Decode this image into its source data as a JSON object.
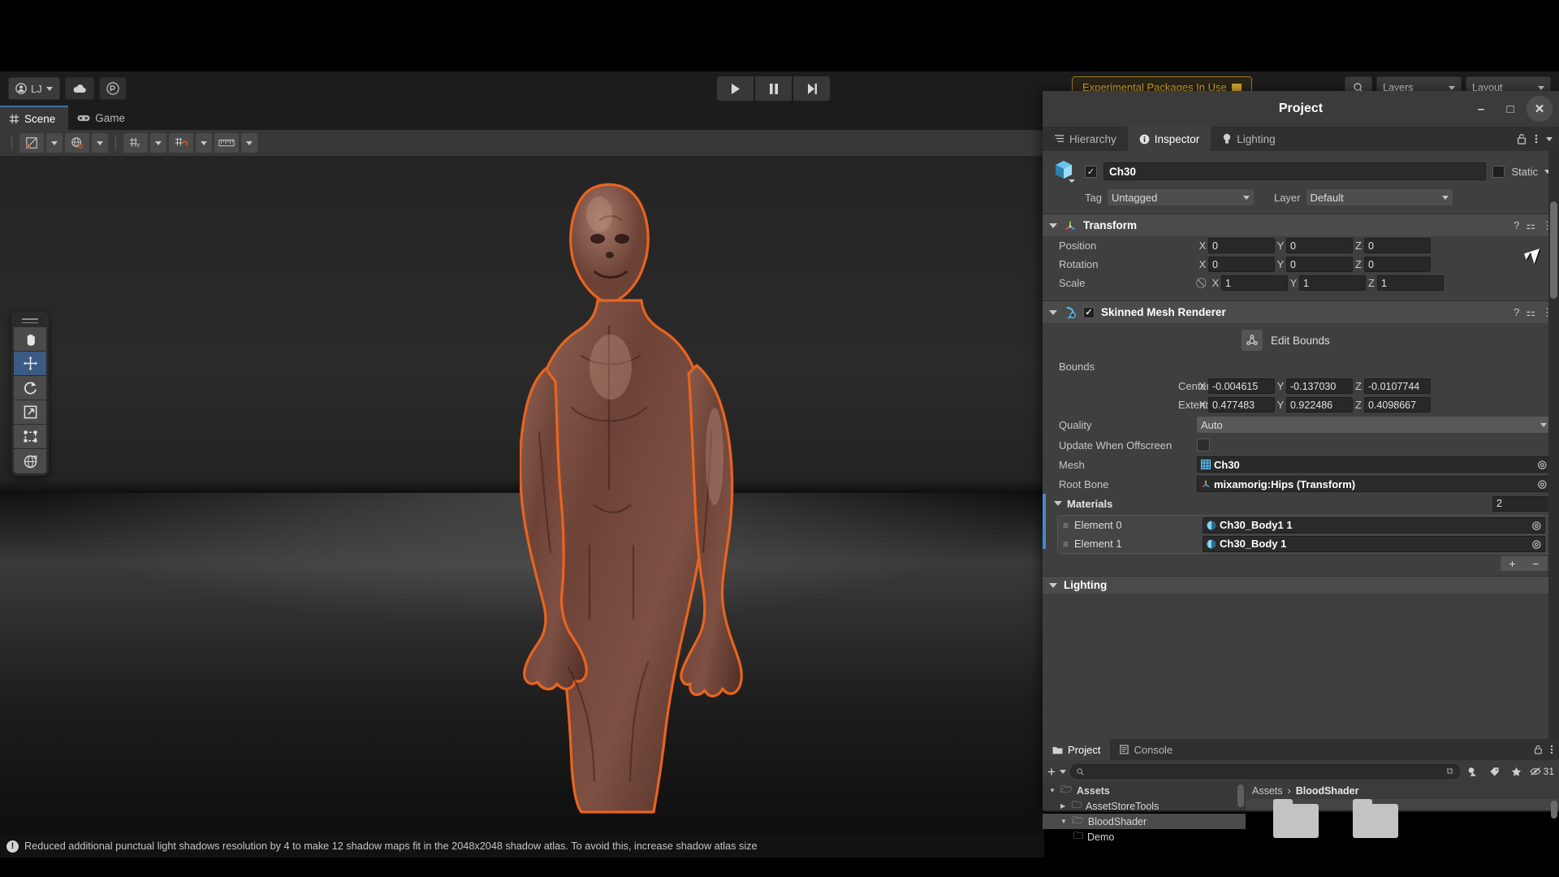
{
  "toolbar": {
    "account_label": "LJ",
    "account_icon": "person-icon",
    "cloud_icon": "cloud-icon",
    "packages_icon": "package-manager-icon",
    "play_icon": "play-icon",
    "pause_icon": "pause-icon",
    "step_icon": "step-icon",
    "experimental_badge": "Experimental Packages In Use",
    "layers_label": "Layers",
    "layout_label": "Layout",
    "search_icon": "search-icon",
    "undo_icon": "undo-icon"
  },
  "scene": {
    "tabs": [
      {
        "label": "Scene",
        "icon": "grid-icon",
        "active": true
      },
      {
        "label": "Game",
        "icon": "gamepad-icon",
        "active": false
      }
    ],
    "toolbar_icons": [
      "shading-mode-icon",
      "world-local-icon",
      "grid-snap-icon",
      "snap-increment-icon",
      "ruler-icon"
    ],
    "tools": [
      {
        "name": "hand-tool",
        "glyph": "✋",
        "selected": false
      },
      {
        "name": "move-tool",
        "glyph": "✥",
        "selected": true
      },
      {
        "name": "rotate-tool",
        "glyph": "↻",
        "selected": false
      },
      {
        "name": "scale-tool",
        "glyph": "↗",
        "selected": false
      },
      {
        "name": "rect-tool",
        "glyph": "⬚",
        "selected": false
      },
      {
        "name": "transform-tool",
        "glyph": "⬤",
        "selected": false
      }
    ],
    "status_message": "Reduced additional punctual light shadows resolution by 4 to make 12 shadow maps fit in the 2048x2048 shadow atlas. To avoid this, increase shadow atlas size",
    "status_icon": "info-icon"
  },
  "project_window": {
    "title": "Project",
    "minimize_label": "–",
    "maximize_label": "□",
    "close_label": "✕"
  },
  "inspector": {
    "tabs": [
      {
        "label": "Hierarchy",
        "icon": "hierarchy-icon",
        "active": false
      },
      {
        "label": "Inspector",
        "icon": "info-icon",
        "active": true
      },
      {
        "label": "Lighting",
        "icon": "bulb-icon",
        "active": false
      }
    ],
    "lock_icon": "lock-icon",
    "menu_icon": "kebab-icon",
    "object": {
      "enabled": true,
      "name": "Ch30",
      "static_label": "Static",
      "static_checked": false,
      "tag_label": "Tag",
      "tag_value": "Untagged",
      "layer_label": "Layer",
      "layer_value": "Default"
    },
    "transform": {
      "title": "Transform",
      "expanded": true,
      "rows": [
        {
          "label": "Position",
          "x": "0",
          "y": "0",
          "z": "0"
        },
        {
          "label": "Rotation",
          "x": "0",
          "y": "0",
          "z": "0"
        },
        {
          "label": "Scale",
          "x": "1",
          "y": "1",
          "z": "1",
          "constrain_icon": "link-off-icon"
        }
      ]
    },
    "skinned_mesh_renderer": {
      "title": "Skinned Mesh Renderer",
      "enabled": true,
      "expanded": true,
      "edit_bounds_label": "Edit Bounds",
      "edit_bounds_icon": "edit-bounds-icon",
      "bounds_label": "Bounds",
      "center": {
        "label": "Center",
        "x": "-0.004615",
        "y": "-0.137030",
        "z": "-0.0107744"
      },
      "extent": {
        "label": "Extent",
        "x": "0.477483",
        "y": "0.922486",
        "z": "0.4098667"
      },
      "quality_label": "Quality",
      "quality_value": "Auto",
      "update_offscreen_label": "Update When Offscreen",
      "update_offscreen_checked": false,
      "mesh_label": "Mesh",
      "mesh_value": "Ch30",
      "mesh_icon": "mesh-icon",
      "root_bone_label": "Root Bone",
      "root_bone_value": "mixamorig:Hips (Transform)",
      "root_bone_icon": "transform-icon",
      "materials_label": "Materials",
      "materials_count": "2",
      "materials": [
        {
          "label": "Element 0",
          "value": "Ch30_Body1 1",
          "icon": "material-icon"
        },
        {
          "label": "Element 1",
          "value": "Ch30_Body 1",
          "icon": "material-icon"
        }
      ],
      "add_label": "+",
      "remove_label": "−"
    },
    "lighting_section": {
      "title": "Lighting",
      "expanded": true
    }
  },
  "project_panel": {
    "tabs": [
      {
        "label": "Project",
        "icon": "folder-icon",
        "active": true
      },
      {
        "label": "Console",
        "icon": "console-icon",
        "active": false
      }
    ],
    "lock_icon": "lock-icon",
    "menu_icon": "kebab-icon",
    "create_label": "+",
    "search_placeholder": "",
    "search_icon": "search-icon",
    "filter_icons": [
      "save-search-icon",
      "type-filter-icon",
      "label-filter-icon",
      "favorite-icon"
    ],
    "hidden_icon": "hidden-eye-icon",
    "hidden_count": "31",
    "tree": [
      {
        "label": "Assets",
        "depth": 0,
        "expanded": true,
        "selected": false
      },
      {
        "label": "AssetStoreTools",
        "depth": 1,
        "expanded": false,
        "selected": false
      },
      {
        "label": "BloodShader",
        "depth": 1,
        "expanded": true,
        "selected": true
      },
      {
        "label": "Demo",
        "depth": 2,
        "expanded": null,
        "selected": false
      }
    ],
    "breadcrumb": [
      "Assets",
      "BloodShader"
    ],
    "grid_items": [
      "folder",
      "folder"
    ]
  },
  "colors": {
    "accent_blue": "#4a86c8",
    "selection_orange": "#e8641e",
    "warning_yellow": "#d5a62f",
    "panel_bg": "#3f3f3f",
    "header_bg": "#4b4b4b"
  }
}
